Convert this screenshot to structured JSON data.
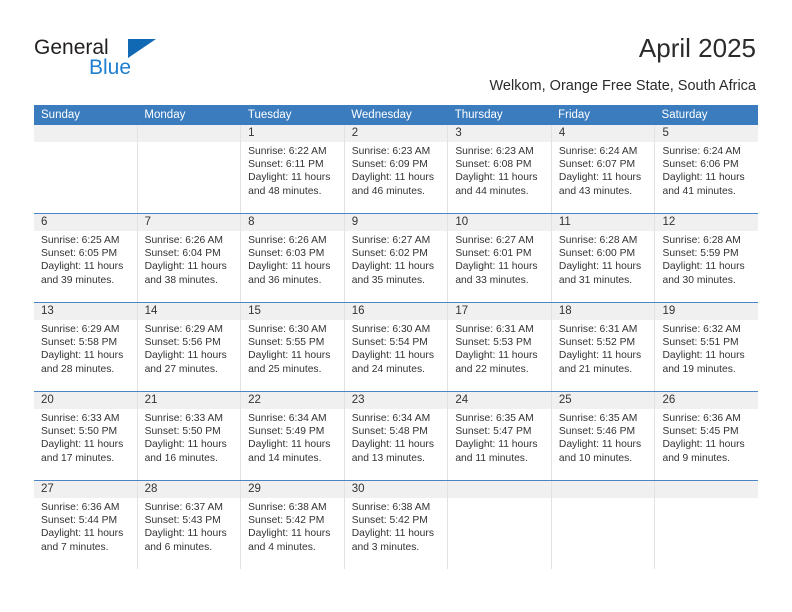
{
  "brand": {
    "word_general": "General",
    "word_blue": "Blue",
    "triangle_color": "#1168b3",
    "blue_text_color": "#1f7fd0"
  },
  "header": {
    "month_title": "April 2025",
    "location": "Welkom, Orange Free State, South Africa"
  },
  "theme": {
    "header_bar_color": "#3a7cbe",
    "daynum_band_color": "#f0f0f0",
    "row_divider_color": "#4a86c5",
    "cell_border_color": "#e2e2e2"
  },
  "weekday_headers": [
    "Sunday",
    "Monday",
    "Tuesday",
    "Wednesday",
    "Thursday",
    "Friday",
    "Saturday"
  ],
  "weeks": [
    [
      {
        "day": "",
        "sunrise": "",
        "sunset": "",
        "daylight_line1": "",
        "daylight_line2": ""
      },
      {
        "day": "",
        "sunrise": "",
        "sunset": "",
        "daylight_line1": "",
        "daylight_line2": ""
      },
      {
        "day": "1",
        "sunrise": "Sunrise: 6:22 AM",
        "sunset": "Sunset: 6:11 PM",
        "daylight_line1": "Daylight: 11 hours",
        "daylight_line2": "and 48 minutes."
      },
      {
        "day": "2",
        "sunrise": "Sunrise: 6:23 AM",
        "sunset": "Sunset: 6:09 PM",
        "daylight_line1": "Daylight: 11 hours",
        "daylight_line2": "and 46 minutes."
      },
      {
        "day": "3",
        "sunrise": "Sunrise: 6:23 AM",
        "sunset": "Sunset: 6:08 PM",
        "daylight_line1": "Daylight: 11 hours",
        "daylight_line2": "and 44 minutes."
      },
      {
        "day": "4",
        "sunrise": "Sunrise: 6:24 AM",
        "sunset": "Sunset: 6:07 PM",
        "daylight_line1": "Daylight: 11 hours",
        "daylight_line2": "and 43 minutes."
      },
      {
        "day": "5",
        "sunrise": "Sunrise: 6:24 AM",
        "sunset": "Sunset: 6:06 PM",
        "daylight_line1": "Daylight: 11 hours",
        "daylight_line2": "and 41 minutes."
      }
    ],
    [
      {
        "day": "6",
        "sunrise": "Sunrise: 6:25 AM",
        "sunset": "Sunset: 6:05 PM",
        "daylight_line1": "Daylight: 11 hours",
        "daylight_line2": "and 39 minutes."
      },
      {
        "day": "7",
        "sunrise": "Sunrise: 6:26 AM",
        "sunset": "Sunset: 6:04 PM",
        "daylight_line1": "Daylight: 11 hours",
        "daylight_line2": "and 38 minutes."
      },
      {
        "day": "8",
        "sunrise": "Sunrise: 6:26 AM",
        "sunset": "Sunset: 6:03 PM",
        "daylight_line1": "Daylight: 11 hours",
        "daylight_line2": "and 36 minutes."
      },
      {
        "day": "9",
        "sunrise": "Sunrise: 6:27 AM",
        "sunset": "Sunset: 6:02 PM",
        "daylight_line1": "Daylight: 11 hours",
        "daylight_line2": "and 35 minutes."
      },
      {
        "day": "10",
        "sunrise": "Sunrise: 6:27 AM",
        "sunset": "Sunset: 6:01 PM",
        "daylight_line1": "Daylight: 11 hours",
        "daylight_line2": "and 33 minutes."
      },
      {
        "day": "11",
        "sunrise": "Sunrise: 6:28 AM",
        "sunset": "Sunset: 6:00 PM",
        "daylight_line1": "Daylight: 11 hours",
        "daylight_line2": "and 31 minutes."
      },
      {
        "day": "12",
        "sunrise": "Sunrise: 6:28 AM",
        "sunset": "Sunset: 5:59 PM",
        "daylight_line1": "Daylight: 11 hours",
        "daylight_line2": "and 30 minutes."
      }
    ],
    [
      {
        "day": "13",
        "sunrise": "Sunrise: 6:29 AM",
        "sunset": "Sunset: 5:58 PM",
        "daylight_line1": "Daylight: 11 hours",
        "daylight_line2": "and 28 minutes."
      },
      {
        "day": "14",
        "sunrise": "Sunrise: 6:29 AM",
        "sunset": "Sunset: 5:56 PM",
        "daylight_line1": "Daylight: 11 hours",
        "daylight_line2": "and 27 minutes."
      },
      {
        "day": "15",
        "sunrise": "Sunrise: 6:30 AM",
        "sunset": "Sunset: 5:55 PM",
        "daylight_line1": "Daylight: 11 hours",
        "daylight_line2": "and 25 minutes."
      },
      {
        "day": "16",
        "sunrise": "Sunrise: 6:30 AM",
        "sunset": "Sunset: 5:54 PM",
        "daylight_line1": "Daylight: 11 hours",
        "daylight_line2": "and 24 minutes."
      },
      {
        "day": "17",
        "sunrise": "Sunrise: 6:31 AM",
        "sunset": "Sunset: 5:53 PM",
        "daylight_line1": "Daylight: 11 hours",
        "daylight_line2": "and 22 minutes."
      },
      {
        "day": "18",
        "sunrise": "Sunrise: 6:31 AM",
        "sunset": "Sunset: 5:52 PM",
        "daylight_line1": "Daylight: 11 hours",
        "daylight_line2": "and 21 minutes."
      },
      {
        "day": "19",
        "sunrise": "Sunrise: 6:32 AM",
        "sunset": "Sunset: 5:51 PM",
        "daylight_line1": "Daylight: 11 hours",
        "daylight_line2": "and 19 minutes."
      }
    ],
    [
      {
        "day": "20",
        "sunrise": "Sunrise: 6:33 AM",
        "sunset": "Sunset: 5:50 PM",
        "daylight_line1": "Daylight: 11 hours",
        "daylight_line2": "and 17 minutes."
      },
      {
        "day": "21",
        "sunrise": "Sunrise: 6:33 AM",
        "sunset": "Sunset: 5:50 PM",
        "daylight_line1": "Daylight: 11 hours",
        "daylight_line2": "and 16 minutes."
      },
      {
        "day": "22",
        "sunrise": "Sunrise: 6:34 AM",
        "sunset": "Sunset: 5:49 PM",
        "daylight_line1": "Daylight: 11 hours",
        "daylight_line2": "and 14 minutes."
      },
      {
        "day": "23",
        "sunrise": "Sunrise: 6:34 AM",
        "sunset": "Sunset: 5:48 PM",
        "daylight_line1": "Daylight: 11 hours",
        "daylight_line2": "and 13 minutes."
      },
      {
        "day": "24",
        "sunrise": "Sunrise: 6:35 AM",
        "sunset": "Sunset: 5:47 PM",
        "daylight_line1": "Daylight: 11 hours",
        "daylight_line2": "and 11 minutes."
      },
      {
        "day": "25",
        "sunrise": "Sunrise: 6:35 AM",
        "sunset": "Sunset: 5:46 PM",
        "daylight_line1": "Daylight: 11 hours",
        "daylight_line2": "and 10 minutes."
      },
      {
        "day": "26",
        "sunrise": "Sunrise: 6:36 AM",
        "sunset": "Sunset: 5:45 PM",
        "daylight_line1": "Daylight: 11 hours",
        "daylight_line2": "and 9 minutes."
      }
    ],
    [
      {
        "day": "27",
        "sunrise": "Sunrise: 6:36 AM",
        "sunset": "Sunset: 5:44 PM",
        "daylight_line1": "Daylight: 11 hours",
        "daylight_line2": "and 7 minutes."
      },
      {
        "day": "28",
        "sunrise": "Sunrise: 6:37 AM",
        "sunset": "Sunset: 5:43 PM",
        "daylight_line1": "Daylight: 11 hours",
        "daylight_line2": "and 6 minutes."
      },
      {
        "day": "29",
        "sunrise": "Sunrise: 6:38 AM",
        "sunset": "Sunset: 5:42 PM",
        "daylight_line1": "Daylight: 11 hours",
        "daylight_line2": "and 4 minutes."
      },
      {
        "day": "30",
        "sunrise": "Sunrise: 6:38 AM",
        "sunset": "Sunset: 5:42 PM",
        "daylight_line1": "Daylight: 11 hours",
        "daylight_line2": "and 3 minutes."
      },
      {
        "day": "",
        "sunrise": "",
        "sunset": "",
        "daylight_line1": "",
        "daylight_line2": ""
      },
      {
        "day": "",
        "sunrise": "",
        "sunset": "",
        "daylight_line1": "",
        "daylight_line2": ""
      },
      {
        "day": "",
        "sunrise": "",
        "sunset": "",
        "daylight_line1": "",
        "daylight_line2": ""
      }
    ]
  ]
}
